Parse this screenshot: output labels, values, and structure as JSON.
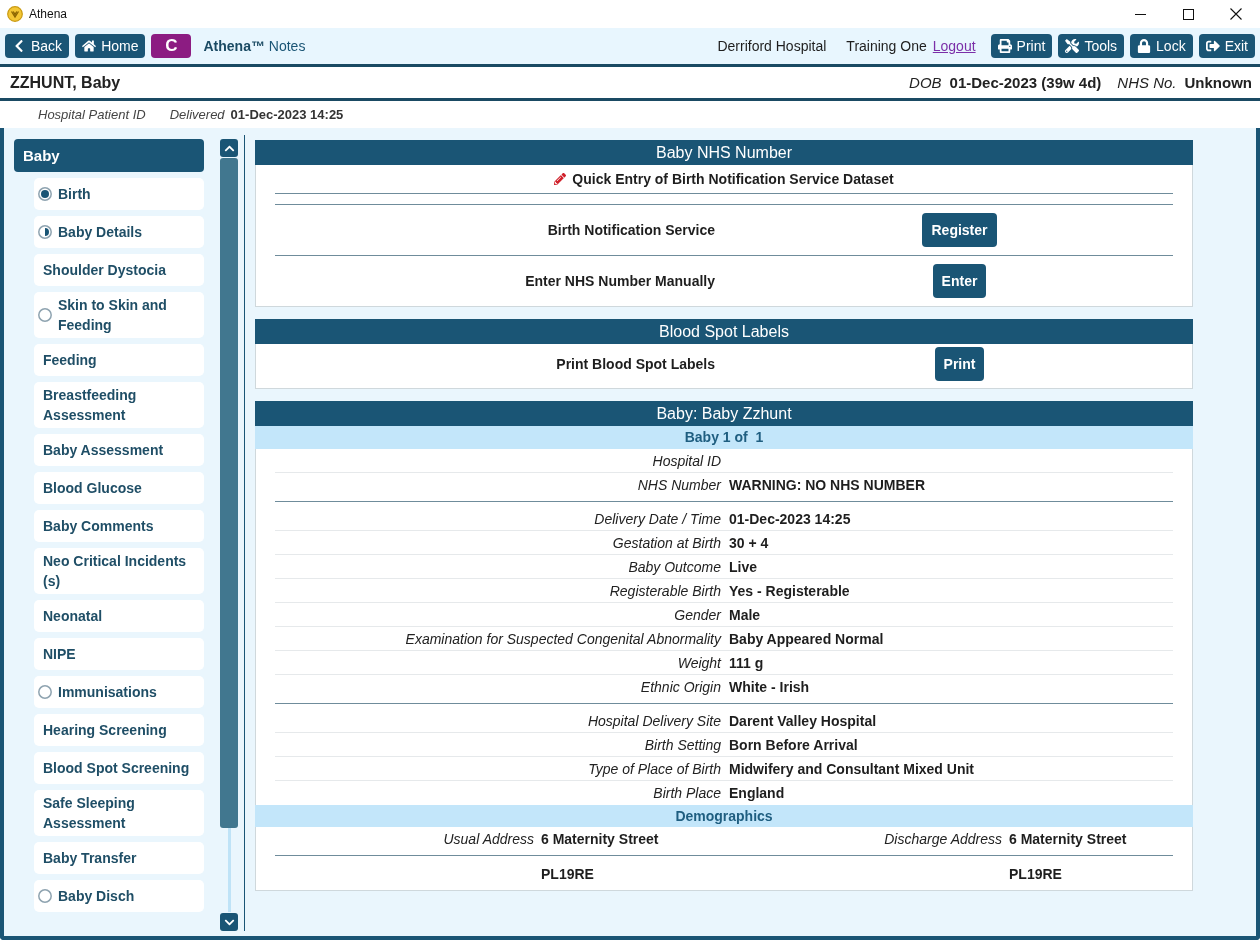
{
  "window": {
    "title": "Athena"
  },
  "toolbar": {
    "left_buttons": [
      {
        "kind": "back",
        "label": "Back"
      },
      {
        "kind": "home",
        "label": "Home"
      },
      {
        "kind": "letter",
        "label": "C"
      }
    ],
    "app_title": "**Athena™** Notes",
    "location": "Derriford Hospital",
    "user": "Training One",
    "logout": "Logout",
    "right_buttons": [
      {
        "kind": "print",
        "label": "Print"
      },
      {
        "kind": "tools",
        "label": "Tools"
      },
      {
        "kind": "lock",
        "label": "Lock"
      },
      {
        "kind": "exit",
        "label": "Exit"
      }
    ]
  },
  "patient": {
    "name": "ZZHUNT, Baby",
    "fields": [
      {
        "label": "DOB",
        "value": "01-Dec-2023 (39w 4d)"
      },
      {
        "label": "NHS No.",
        "value": "Unknown"
      }
    ]
  },
  "info_bar": [
    {
      "label": "Hospital Patient ID"
    },
    {
      "label": "Delivered",
      "value": "01-Dec-2023 14:25"
    }
  ],
  "sidebar": {
    "header": "Baby",
    "items": [
      {
        "label": "Birth",
        "kind": "complete"
      },
      {
        "label": "Baby Details",
        "kind": "partial"
      },
      {
        "label": "Shoulder Dystocia",
        "kind": "plain"
      },
      {
        "label": "Skin to Skin and Feeding",
        "kind": "open"
      },
      {
        "label": "Feeding",
        "kind": "plain"
      },
      {
        "label": "Breastfeeding Assessment",
        "kind": "plain"
      },
      {
        "label": "Baby Assessment",
        "kind": "plain"
      },
      {
        "label": "Blood Glucose",
        "kind": "plain"
      },
      {
        "label": "Baby Comments",
        "kind": "plain"
      },
      {
        "label": "Neo Critical Incidents (s)",
        "kind": "plain"
      },
      {
        "label": "Neonatal",
        "kind": "plain"
      },
      {
        "label": "NIPE",
        "kind": "plain"
      },
      {
        "label": "Immunisations",
        "kind": "open"
      },
      {
        "label": "Hearing Screening",
        "kind": "plain"
      },
      {
        "label": "Blood Spot Screening",
        "kind": "plain"
      },
      {
        "label": "Safe Sleeping Assessment",
        "kind": "plain"
      },
      {
        "label": "Baby Transfer",
        "kind": "plain"
      },
      {
        "label": "Baby Disch",
        "kind": "open"
      }
    ]
  },
  "panels": [
    {
      "kind": "actions",
      "title": "Baby NHS Number",
      "rows": [
        {
          "kind": "link",
          "label": "Quick Entry of Birth Notification Service Dataset"
        },
        {
          "kind": "action",
          "label": "Birth Notification Service",
          "button": "Register"
        },
        {
          "kind": "action",
          "label": "Enter NHS Number Manually",
          "button": "Enter"
        }
      ]
    },
    {
      "kind": "actions",
      "title": "Blood Spot Labels",
      "rows": [
        {
          "kind": "action",
          "label": "Print Blood Spot Labels",
          "button": "Print"
        }
      ]
    },
    {
      "kind": "details",
      "title": "Baby: Baby Zzhunt",
      "subheader": "Baby 1 of  1",
      "groups": [
        [
          {
            "label": "Hospital ID"
          },
          {
            "label": "NHS Number",
            "value": "WARNING: NO NHS NUMBER"
          }
        ],
        [
          {
            "label": "Delivery Date / Time",
            "value": "01-Dec-2023 14:25"
          },
          {
            "label": "Gestation at Birth",
            "value": "30 + 4"
          },
          {
            "label": "Baby Outcome",
            "value": "Live"
          },
          {
            "label": "Registerable Birth",
            "value": "Yes - Registerable"
          },
          {
            "label": "Gender",
            "value": "Male"
          },
          {
            "label": "Examination for Suspected Congenital Abnormality",
            "value": "Baby Appeared Normal"
          },
          {
            "label": "Weight",
            "value": "111 g"
          },
          {
            "label": "Ethnic Origin",
            "value": "White - Irish"
          }
        ],
        [
          {
            "label": "Hospital Delivery Site",
            "value": "Darent Valley Hospital"
          },
          {
            "label": "Birth Setting",
            "value": "Born Before Arrival"
          },
          {
            "label": "Type of Place of Birth",
            "value": "Midwifery and Consultant Mixed Unit"
          },
          {
            "label": "Birth Place",
            "value": "England"
          }
        ]
      ],
      "demographics": {
        "title": "Demographics",
        "addresses": [
          {
            "label": "Usual Address",
            "lines": [
              "6 Maternity Street",
              "PL19RE"
            ]
          },
          {
            "label": "Discharge Address",
            "lines": [
              "6 Maternity Street",
              "PL19RE"
            ]
          }
        ]
      }
    }
  ]
}
